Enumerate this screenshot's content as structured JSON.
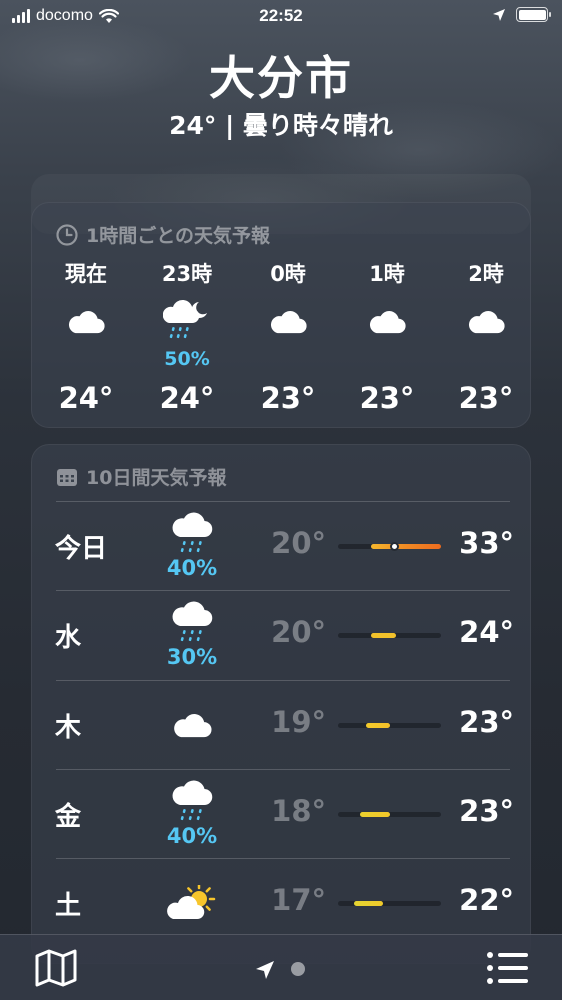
{
  "status_bar": {
    "carrier": "docomo",
    "time": "22:52"
  },
  "header": {
    "city": "大分市",
    "summary": "24° | 曇り時々晴れ"
  },
  "hourly": {
    "title": "1時間ごとの天気予報",
    "items": [
      {
        "time": "現在",
        "icon": "cloud-icon",
        "precip": "",
        "temp": "24°"
      },
      {
        "time": "23時",
        "icon": "rain-moon-icon",
        "precip": "50%",
        "temp": "24°"
      },
      {
        "time": "0時",
        "icon": "cloud-icon",
        "precip": "",
        "temp": "23°"
      },
      {
        "time": "1時",
        "icon": "cloud-icon",
        "precip": "",
        "temp": "23°"
      },
      {
        "time": "2時",
        "icon": "cloud-icon",
        "precip": "",
        "temp": "23°"
      }
    ]
  },
  "daily": {
    "title": "10日間天気予報",
    "items": [
      {
        "day": "今日",
        "icon": "rain-cloud-icon",
        "precip": "40%",
        "low": "20°",
        "high": "33°",
        "range_start": 0.32,
        "range_end": 1.0,
        "current": 0.55,
        "gradient": [
          "#f6b72d",
          "#f08a24",
          "#ed6c1f"
        ]
      },
      {
        "day": "水",
        "icon": "rain-cloud-icon",
        "precip": "30%",
        "low": "20°",
        "high": "24°",
        "range_start": 0.32,
        "range_end": 0.56,
        "gradient": [
          "#f2c12b",
          "#f2c12b"
        ]
      },
      {
        "day": "木",
        "icon": "cloud-icon",
        "precip": "",
        "low": "19°",
        "high": "23°",
        "range_start": 0.27,
        "range_end": 0.5,
        "gradient": [
          "#f4cb2b",
          "#f4c02a"
        ]
      },
      {
        "day": "金",
        "icon": "rain-cloud-icon",
        "precip": "40%",
        "low": "18°",
        "high": "23°",
        "range_start": 0.21,
        "range_end": 0.5,
        "gradient": [
          "#ecd22e",
          "#f2c72a"
        ]
      },
      {
        "day": "土",
        "icon": "partly-sunny-icon",
        "precip": "",
        "low": "17°",
        "high": "22°",
        "range_start": 0.16,
        "range_end": 0.44,
        "gradient": [
          "#e5d532",
          "#f0c92b"
        ]
      }
    ]
  },
  "colors": {
    "precip": "#55c7f3",
    "background_top": "#4b535e",
    "background_bottom": "#232830"
  }
}
